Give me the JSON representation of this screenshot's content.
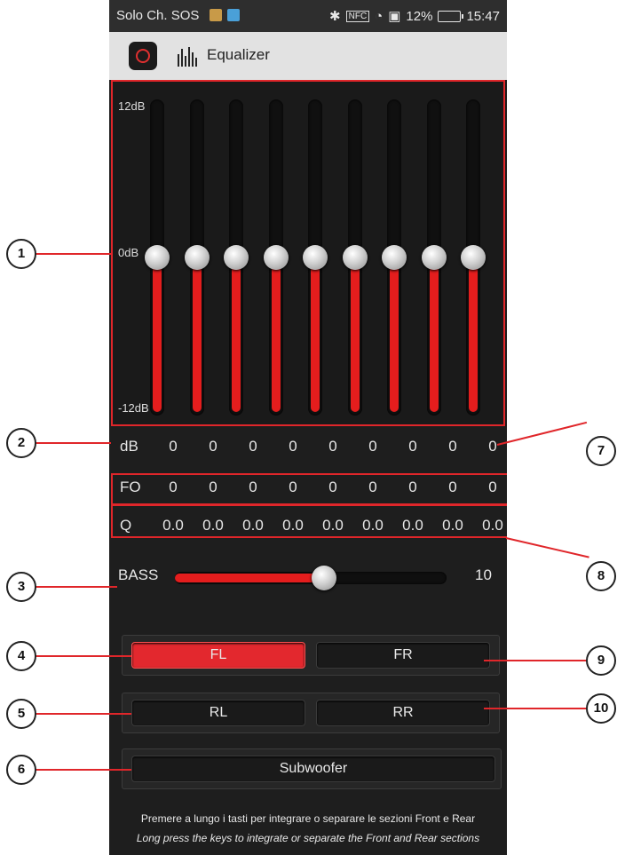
{
  "status_bar": {
    "carrier": "Solo Ch. SOS",
    "battery": "12%",
    "time": "15:47"
  },
  "app_bar": {
    "title": "Equalizer"
  },
  "equalizer": {
    "scale_top": "12dB",
    "scale_mid": "0dB",
    "scale_bottom": "-12dB",
    "band_levels_db": [
      0,
      0,
      0,
      0,
      0,
      0,
      0,
      0,
      0
    ],
    "range_db": [
      -12,
      12
    ]
  },
  "rows": {
    "db": {
      "label": "dB",
      "values": [
        "0",
        "0",
        "0",
        "0",
        "0",
        "0",
        "0",
        "0",
        "0"
      ]
    },
    "fo": {
      "label": "FO",
      "values": [
        "0",
        "0",
        "0",
        "0",
        "0",
        "0",
        "0",
        "0",
        "0"
      ]
    },
    "q": {
      "label": "Q",
      "values": [
        "0.0",
        "0.0",
        "0.0",
        "0.0",
        "0.0",
        "0.0",
        "0.0",
        "0.0",
        "0.0"
      ]
    }
  },
  "bass": {
    "label": "BASS",
    "value": "10",
    "level_fraction": 0.55
  },
  "channels": {
    "fl": "FL",
    "fr": "FR",
    "rl": "RL",
    "rr": "RR",
    "subwoofer": "Subwoofer"
  },
  "notice": {
    "italian": "Premere a lungo i tasti per integrare o separare le sezioni Front e Rear",
    "english": "Long press the keys to integrate or separate the Front and Rear sections"
  },
  "callouts": [
    "1",
    "2",
    "3",
    "4",
    "5",
    "6",
    "7",
    "8",
    "9",
    "10"
  ],
  "colors": {
    "accent": "#e41d1d",
    "background": "#1e1e1e"
  }
}
